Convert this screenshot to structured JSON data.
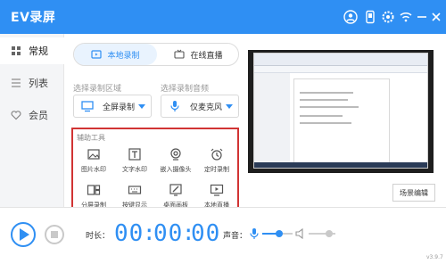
{
  "app": {
    "title": "EV录屏",
    "accent": "#2f8ff3",
    "alert_border": "#d13434"
  },
  "window_controls": [
    {
      "name": "user-icon"
    },
    {
      "name": "phone-icon"
    },
    {
      "name": "gear-icon"
    },
    {
      "name": "wifi-icon"
    },
    {
      "name": "minimize-icon"
    },
    {
      "name": "close-icon"
    }
  ],
  "sidebar": {
    "items": [
      {
        "label": "常规",
        "icon": "settings-icon",
        "active": true
      },
      {
        "label": "列表",
        "icon": "list-icon",
        "active": false
      },
      {
        "label": "会员",
        "icon": "heart-icon",
        "active": false
      }
    ]
  },
  "mode_tabs": [
    {
      "label": "本地录制",
      "icon": "video-icon",
      "active": true
    },
    {
      "label": "在线直播",
      "icon": "tv-icon",
      "active": false
    }
  ],
  "record_area": {
    "label": "选择录制区域",
    "value": "全屏录制",
    "icon": "monitor-icon"
  },
  "audio": {
    "label": "选择录制音频",
    "value": "仅麦克风",
    "icon": "microphone-icon"
  },
  "aux_tools": {
    "title": "辅助工具",
    "items": [
      {
        "label": "图片水印",
        "icon": "image-icon"
      },
      {
        "label": "文字水印",
        "icon": "text-icon"
      },
      {
        "label": "嵌入摄像头",
        "icon": "camera-icon"
      },
      {
        "label": "定时录制",
        "icon": "alarm-icon"
      },
      {
        "label": "分屏录制",
        "icon": "split-screen-icon"
      },
      {
        "label": "按键显示",
        "icon": "keyboard-icon"
      },
      {
        "label": "桌面画板",
        "icon": "drawing-board-icon"
      },
      {
        "label": "本地直播",
        "icon": "live-icon"
      }
    ]
  },
  "scene_button": {
    "label": "场景编辑"
  },
  "bottom": {
    "duration_label": "时长：",
    "time": {
      "hh": "00",
      "mm": "00",
      "ss": "00"
    },
    "sound_label": "声音：",
    "mic_level": 0.55,
    "speaker_level": 0.75,
    "version": "v3.9.7"
  }
}
